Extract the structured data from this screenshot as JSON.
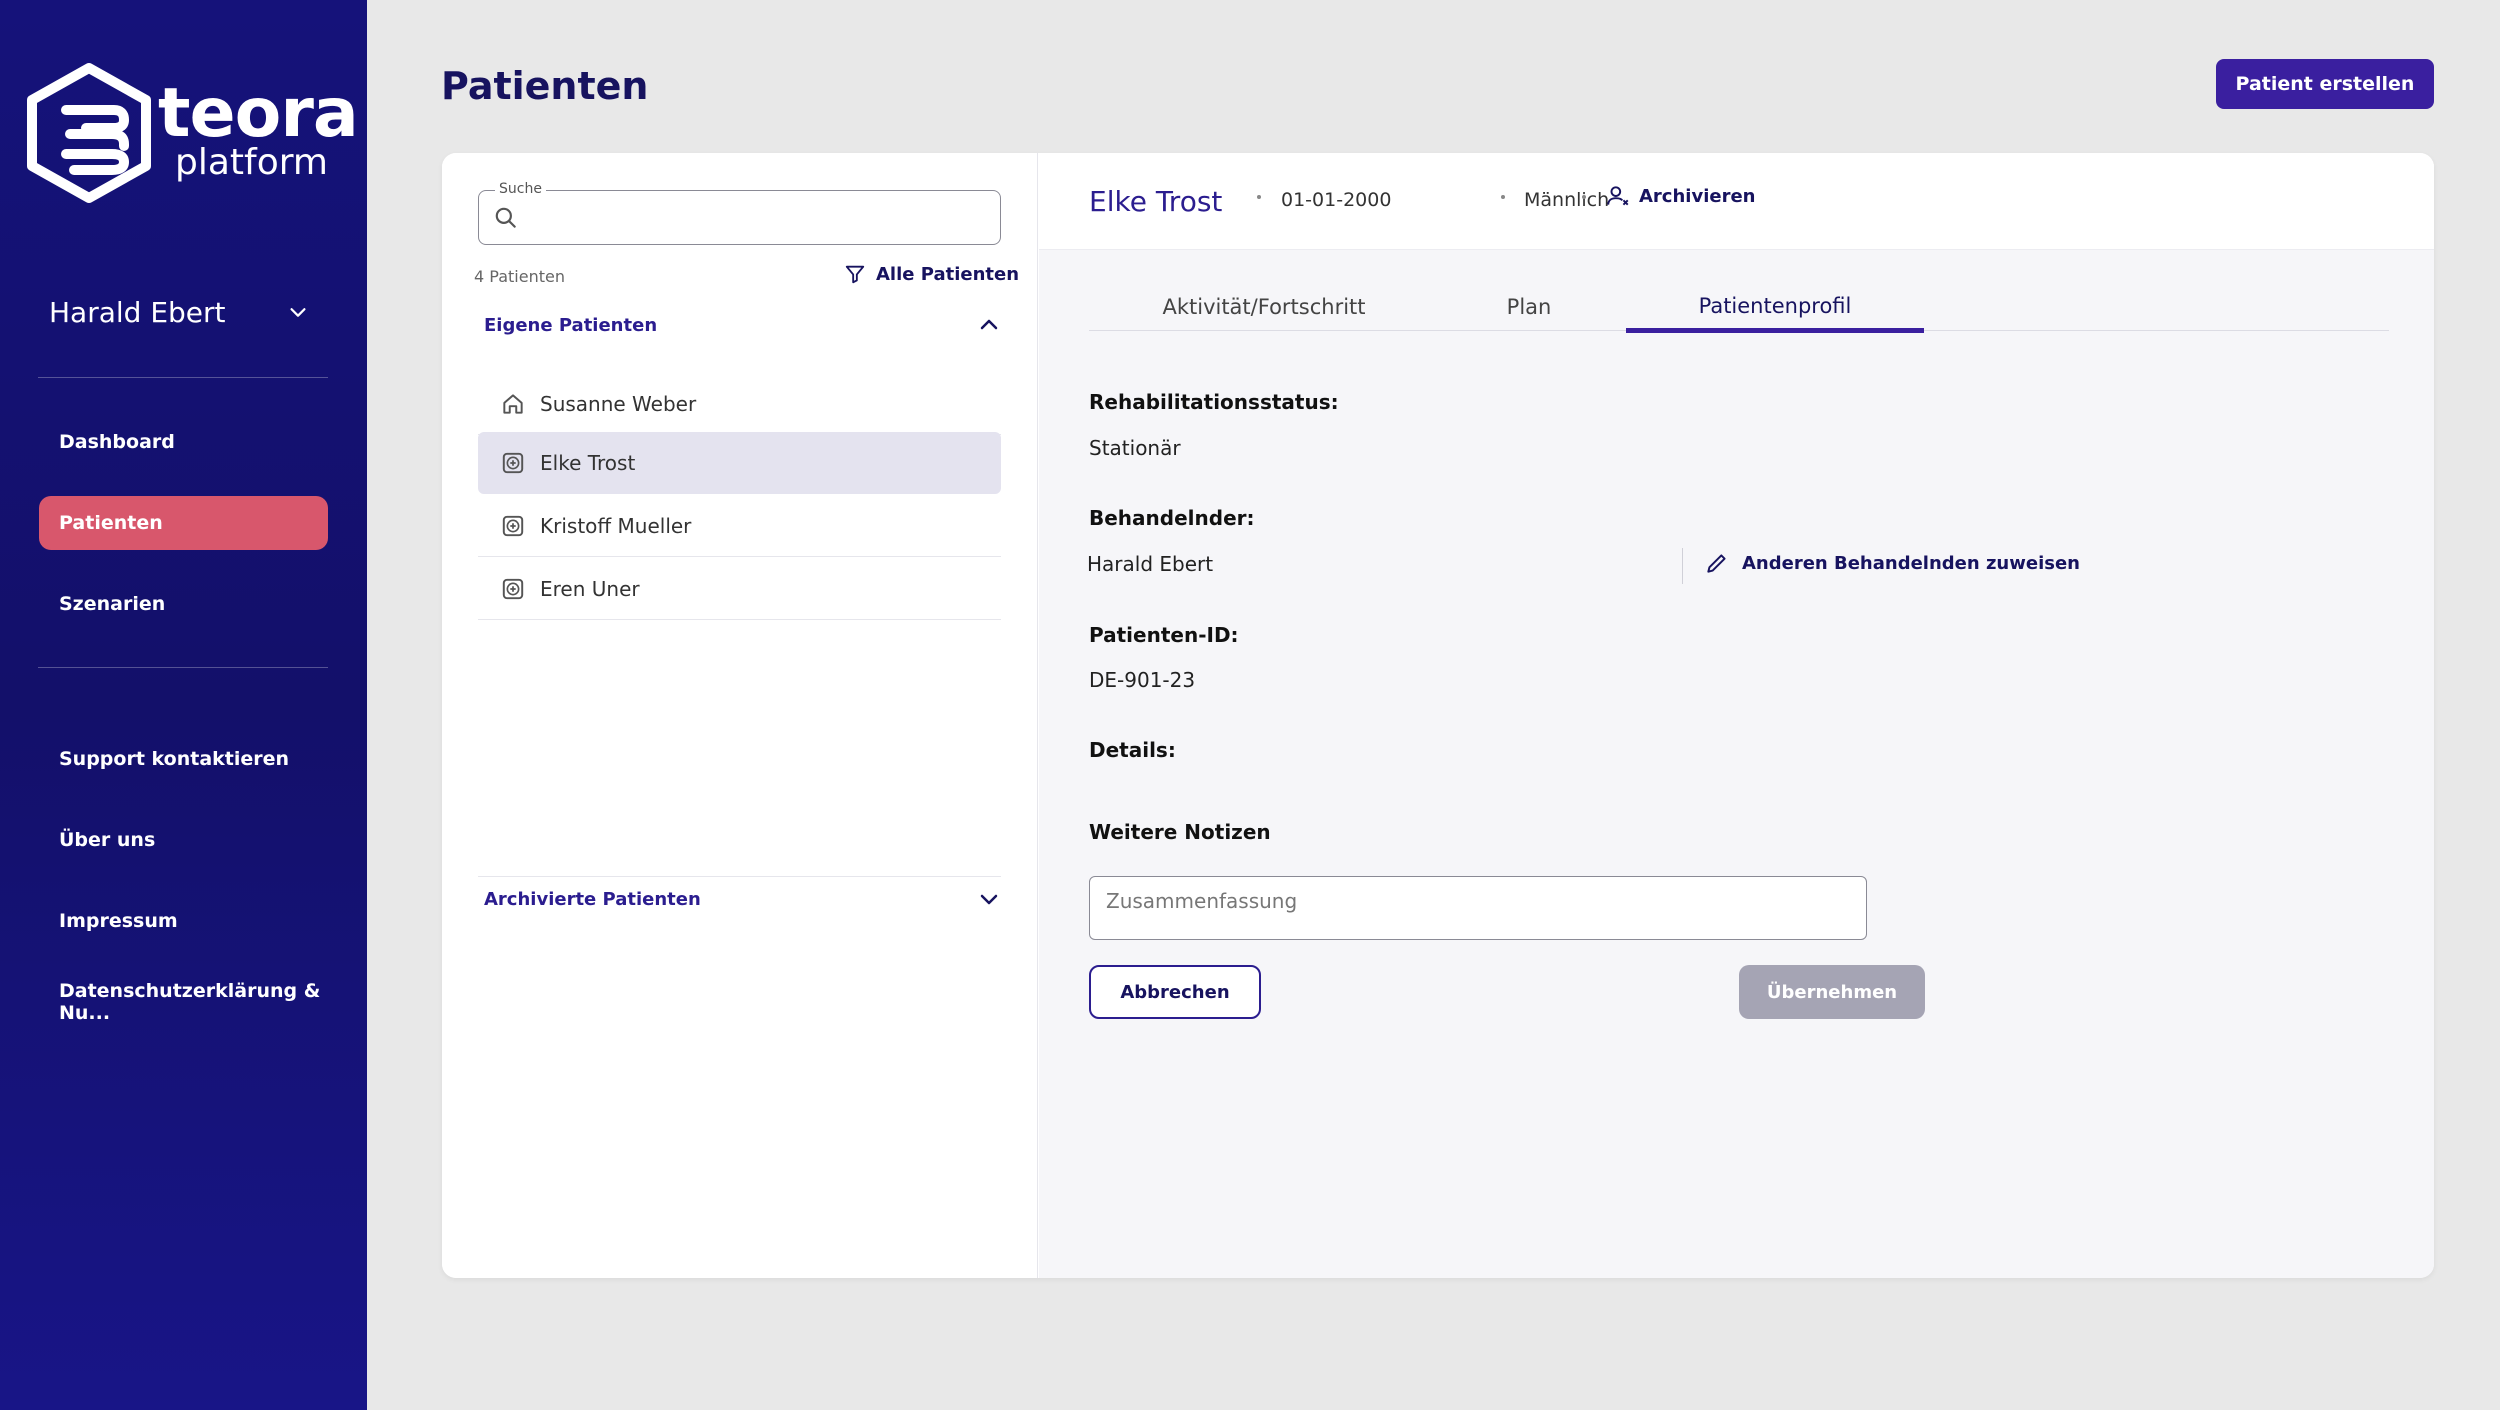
{
  "brand": {
    "name": "teora",
    "sub": "platform"
  },
  "sidebar": {
    "user_name": "Harald Ebert",
    "nav": [
      {
        "label": "Dashboard",
        "active": false
      },
      {
        "label": "Patienten",
        "active": true
      },
      {
        "label": "Szenarien",
        "active": false
      }
    ],
    "footer_nav": [
      {
        "label": "Support kontaktieren"
      },
      {
        "label": "Über uns"
      },
      {
        "label": "Impressum"
      },
      {
        "label": "Datenschutzerklärung & Nu..."
      }
    ]
  },
  "header": {
    "title": "Patienten",
    "create_button": "Patient erstellen"
  },
  "list": {
    "search_label": "Suche",
    "search_value": "",
    "count": "4",
    "count_label": "Patienten",
    "filter_label": "Alle Patienten",
    "own_section": "Eigene Patienten",
    "archived_section": "Archivierte Patienten",
    "patients": [
      {
        "name": "Susanne Weber",
        "icon": "home-icon"
      },
      {
        "name": "Elke Trost",
        "icon": "medical-cross-icon",
        "selected": true
      },
      {
        "name": "Kristoff Mueller",
        "icon": "medical-cross-icon"
      },
      {
        "name": "Eren Uner",
        "icon": "medical-cross-icon"
      }
    ]
  },
  "detail": {
    "name": "Elke Trost",
    "birthdate": "01-01-2000",
    "gender": "Männlich",
    "archive_label": "Archivieren",
    "tabs": [
      {
        "label": "Aktivität/Fortschritt"
      },
      {
        "label": "Plan"
      },
      {
        "label": "Patientenprofil",
        "active": true
      }
    ],
    "rehab_label": "Rehabilitationsstatus:",
    "rehab_value": "Stationär",
    "therapist_label": "Behandelnder:",
    "therapist_value": "Harald Ebert",
    "assign_label": "Anderen Behandelnden zuweisen",
    "patient_id_label": "Patienten-ID:",
    "patient_id_value": "DE-901-23",
    "details_label": "Details:",
    "notes_label": "Weitere Notizen",
    "summary_placeholder": "Zusammenfassung",
    "cancel_label": "Abbrechen",
    "apply_label": "Übernehmen"
  },
  "colors": {
    "sidebar": "#15127a",
    "accent": "#3a1f9f",
    "active_nav": "#d8576c",
    "disabled_button": "#a5a4b4"
  }
}
